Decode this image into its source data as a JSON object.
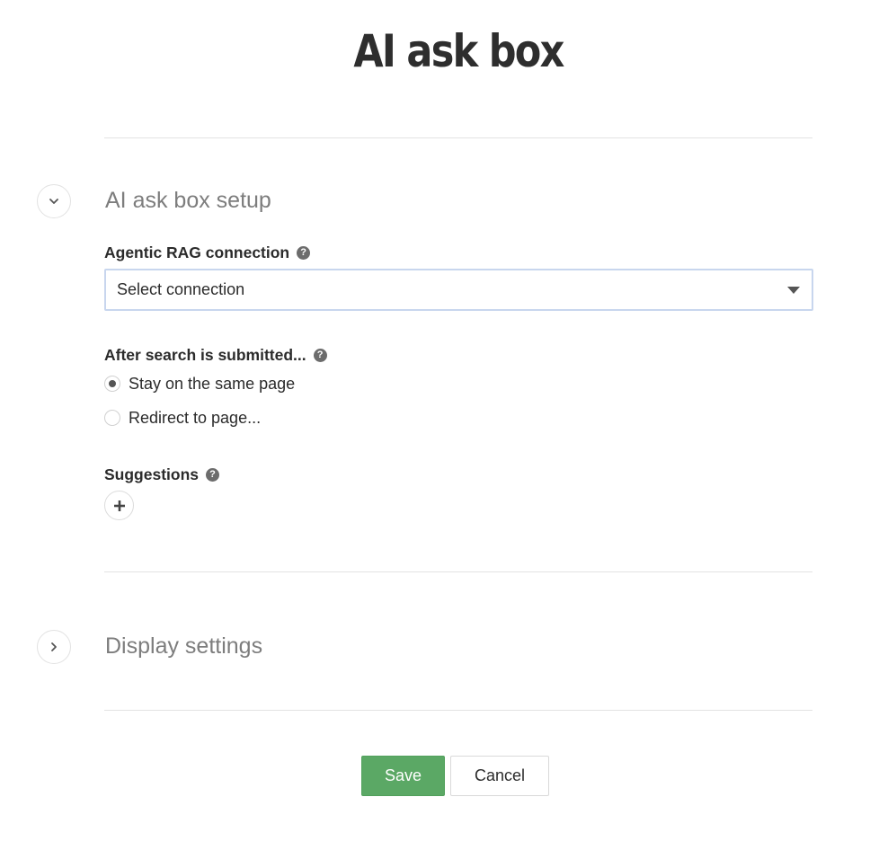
{
  "page": {
    "title": "AI ask box"
  },
  "sections": {
    "setup": {
      "title": "AI ask box setup",
      "expanded": true,
      "toggle_icon": "chevron-down-icon"
    },
    "display": {
      "title": "Display settings",
      "expanded": false,
      "toggle_icon": "chevron-right-icon"
    }
  },
  "form": {
    "connection": {
      "label": "Agentic RAG connection",
      "help_icon": "question-circle-icon",
      "selected_value": "Select connection"
    },
    "after_search": {
      "label": "After search is submitted...",
      "help_icon": "question-circle-icon",
      "options": [
        {
          "label": "Stay on the same page",
          "checked": true
        },
        {
          "label": "Redirect to page...",
          "checked": false
        }
      ]
    },
    "suggestions": {
      "label": "Suggestions",
      "help_icon": "question-circle-icon",
      "add_icon": "plus-icon"
    }
  },
  "actions": {
    "save_label": "Save",
    "cancel_label": "Cancel"
  },
  "colors": {
    "primary_button": "#5ba865",
    "select_border": "#c8d6ee",
    "section_title": "#7d7d7d"
  }
}
